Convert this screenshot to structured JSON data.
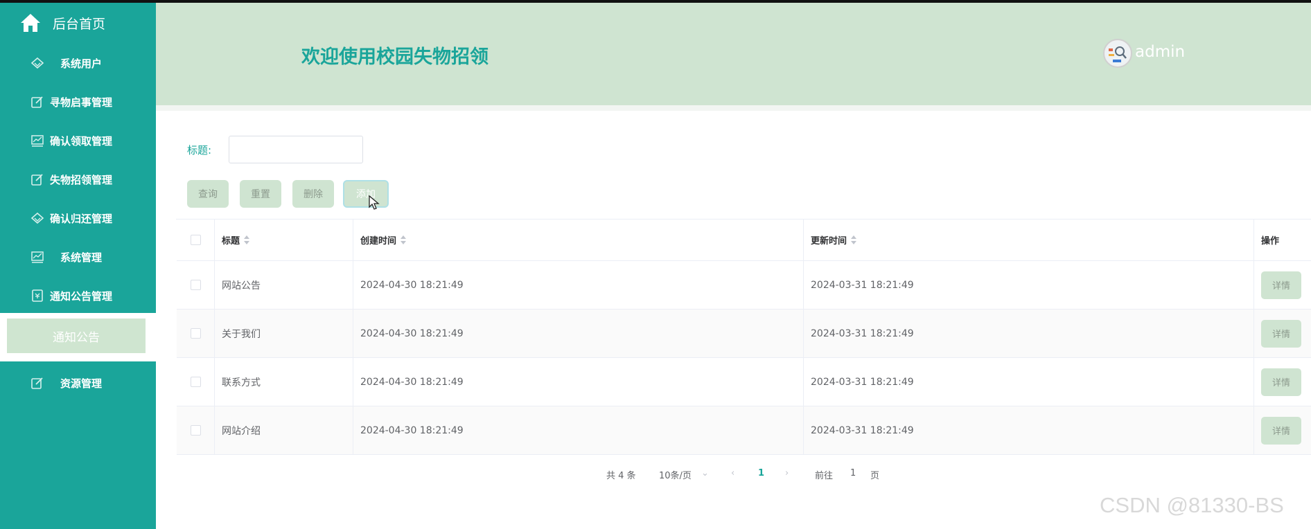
{
  "sidebar": {
    "home_label": "后台首页",
    "items": [
      {
        "label": "系统用户",
        "icon": "diamond-icon"
      },
      {
        "label": "寻物启事管理",
        "icon": "edit-icon"
      },
      {
        "label": "确认领取管理",
        "icon": "chart-icon"
      },
      {
        "label": "失物招领管理",
        "icon": "edit-icon"
      },
      {
        "label": "确认归还管理",
        "icon": "diamond-icon"
      },
      {
        "label": "系统管理",
        "icon": "chart-icon"
      },
      {
        "label": "通知公告管理",
        "icon": "ticket-icon"
      },
      {
        "label": "资源管理",
        "icon": "edit-icon"
      }
    ],
    "active_submenu": "通知公告"
  },
  "header": {
    "title": "欢迎使用校园失物招领",
    "username": "admin"
  },
  "search": {
    "label": "标题:",
    "value": "",
    "placeholder": ""
  },
  "buttons": {
    "query": "查询",
    "reset": "重置",
    "delete": "删除",
    "add": "添加"
  },
  "table": {
    "columns": [
      "标题",
      "创建时间",
      "更新时间",
      "操作"
    ],
    "rows": [
      {
        "title": "网站公告",
        "created": "2024-04-30 18:21:49",
        "updated": "2024-03-31 18:21:49",
        "action": "详情"
      },
      {
        "title": "关于我们",
        "created": "2024-04-30 18:21:49",
        "updated": "2024-03-31 18:21:49",
        "action": "详情"
      },
      {
        "title": "联系方式",
        "created": "2024-04-30 18:21:49",
        "updated": "2024-03-31 18:21:49",
        "action": "详情"
      },
      {
        "title": "网站介绍",
        "created": "2024-04-30 18:21:49",
        "updated": "2024-03-31 18:21:49",
        "action": "详情"
      }
    ]
  },
  "pagination": {
    "total": "共 4 条",
    "page_size": "10条/页",
    "current_page": "1",
    "goto_label": "前往",
    "goto_value": "1",
    "goto_unit": "页"
  },
  "watermark": "CSDN @81330-BS",
  "colors": {
    "primary": "#1aa59a",
    "header_bg": "#cfe4d1",
    "button_bg": "#cfe4d1"
  }
}
